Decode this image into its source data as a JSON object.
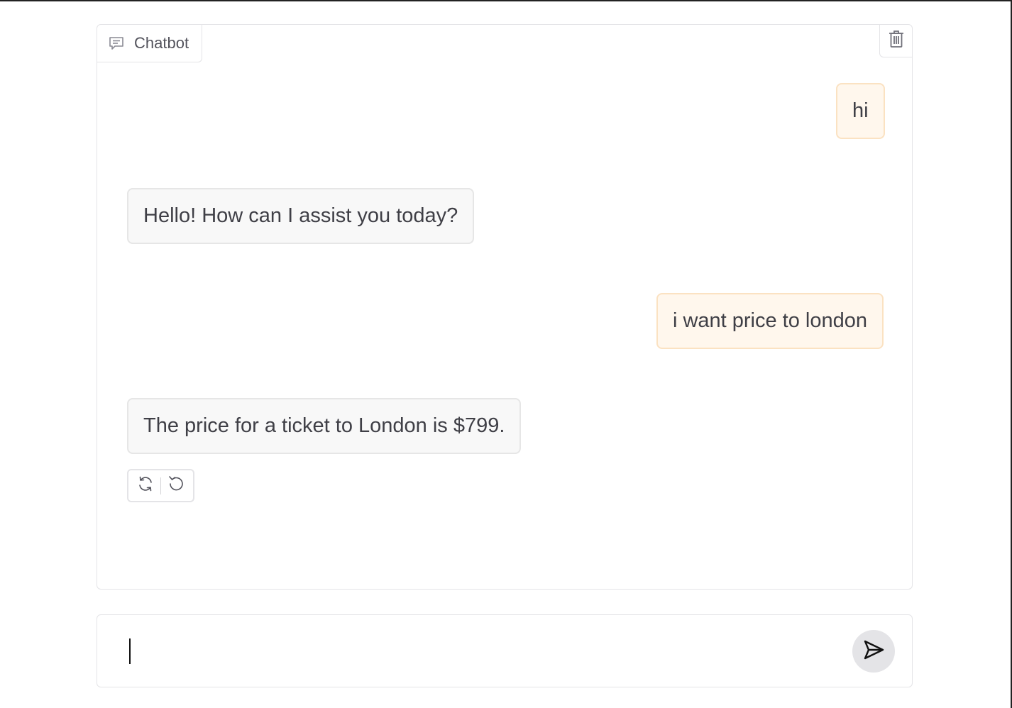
{
  "chatbot": {
    "label": "Chatbot",
    "icon": "chat-bubble-icon",
    "clear_icon": "trash-icon"
  },
  "messages": [
    {
      "role": "user",
      "text": "hi"
    },
    {
      "role": "bot",
      "text": "Hello! How can I assist you today?"
    },
    {
      "role": "user",
      "text": "i want price to london"
    },
    {
      "role": "bot",
      "text": "The price for a ticket to London is $799."
    }
  ],
  "message_actions": {
    "retry_icon": "refresh-icon",
    "undo_icon": "undo-icon"
  },
  "input": {
    "value": "",
    "placeholder": "",
    "send_icon": "send-icon"
  },
  "colors": {
    "user_bubble_bg": "#fff7ed",
    "user_bubble_border": "#fbe2c2",
    "bot_bubble_bg": "#f8f8f8",
    "send_button_bg": "#e4e4e7"
  }
}
